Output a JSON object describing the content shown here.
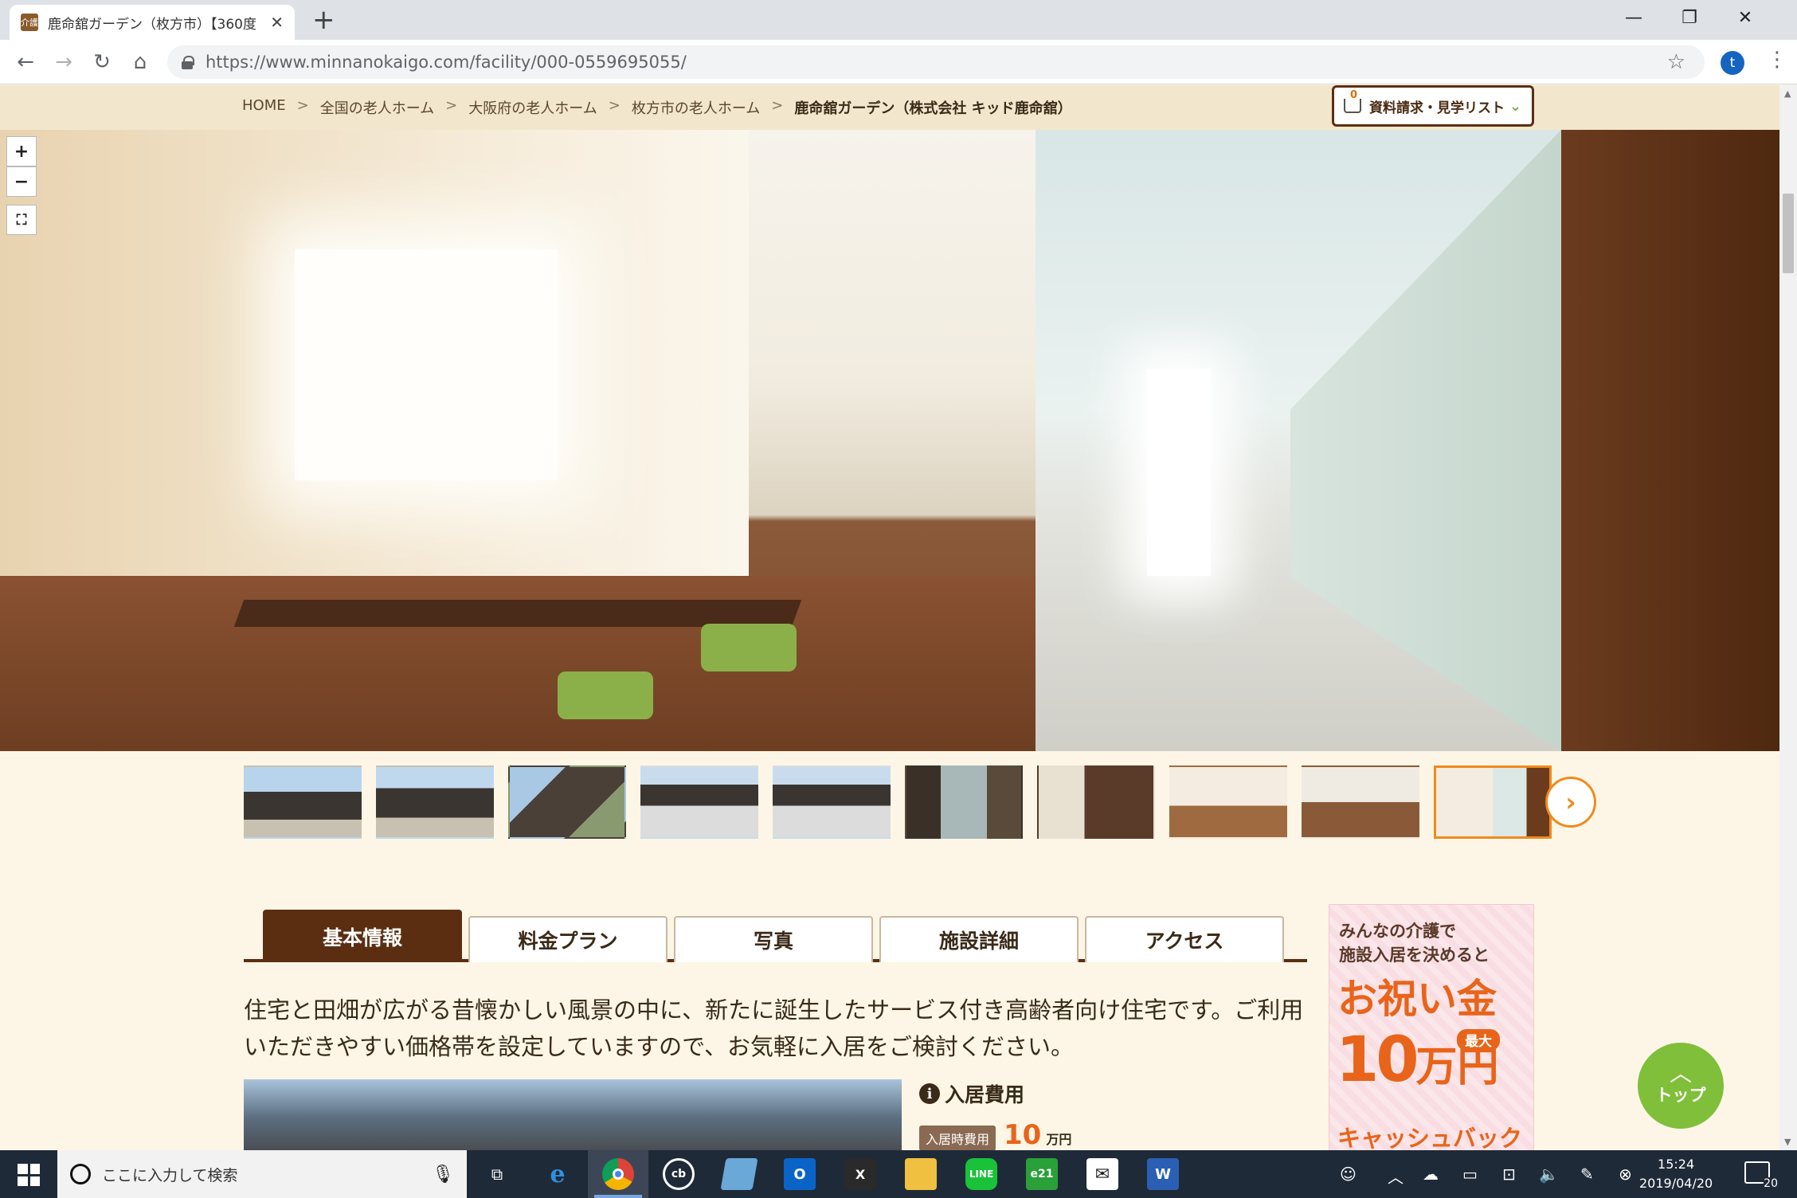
{
  "browser": {
    "tab_title": "鹿命舘ガーデン（枚方市）【360度",
    "favicon_text": "介護",
    "url": "https://www.minnanokaigo.com/facility/000-0559695055/",
    "profile_initial": "t"
  },
  "breadcrumb": {
    "items": [
      "HOME",
      "全国の老人ホーム",
      "大阪府の老人ホーム",
      "枚方市の老人ホーム"
    ],
    "current": "鹿命舘ガーデン（株式会社 キッド鹿命舘）"
  },
  "request_list": {
    "count": "0",
    "label": "資料請求・見学リスト"
  },
  "map_controls": {
    "zoom_in": "+",
    "zoom_out": "−"
  },
  "thumbnails": {
    "count": 10,
    "active_index": 9
  },
  "tabs": [
    "基本情報",
    "料金プラン",
    "写真",
    "施設詳細",
    "アクセス"
  ],
  "description": "住宅と田畑が広がる昔懐かしい風景の中に、新たに誕生したサービス付き高齢者向け住宅です。ご利用いただきやすい価格帯を設定していますので、お気軽に入居をご検討ください。",
  "cost": {
    "heading": "入居費用",
    "badge": "入居時費用",
    "value": "10",
    "unit": "万円"
  },
  "ad": {
    "line1": "みんなの介護で",
    "line2": "施設入居を決めると",
    "big": "お祝い金",
    "max": "最大",
    "amount": "10",
    "amount_unit": "万円",
    "cashback": "キャッシュバック"
  },
  "top_button": {
    "label": "トップ"
  },
  "taskbar": {
    "search_placeholder": "ここに入力して検索",
    "time": "15:24",
    "date": "2019/04/20",
    "notifications": "20"
  },
  "colors": {
    "accent_brown": "#5b2e12",
    "accent_orange": "#f08a1c",
    "cost_orange": "#e8641a",
    "top_green": "#7fbf3a",
    "page_bg": "#fdf6e6"
  }
}
